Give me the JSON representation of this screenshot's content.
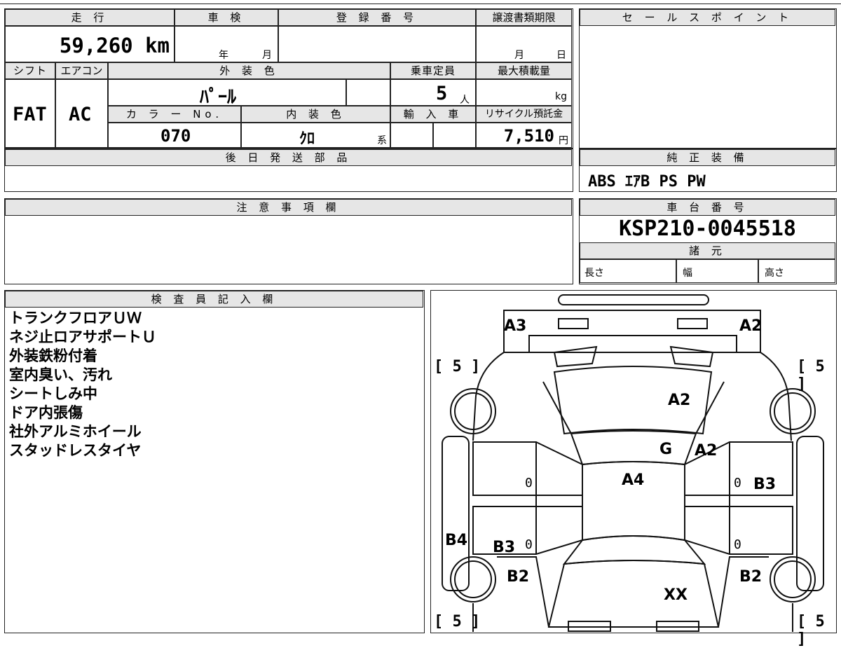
{
  "vehicle": {
    "mileage_label": "走 行",
    "mileage_value": "59,260 km",
    "inspection_label": "車 検",
    "inspection_year": "年",
    "inspection_month": "月",
    "registration_label": "登 録 番 号",
    "transfer_label": "譲渡書類期限",
    "transfer_month": "月",
    "transfer_day": "日",
    "shift_label": "シフト",
    "shift_value": "FAT",
    "aircon_label": "エアコン",
    "aircon_value": "AC",
    "exterior_label": "外 装 色",
    "exterior_value": "ﾊﾟｰﾙ",
    "capacity_label": "乗車定員",
    "capacity_value": "5",
    "capacity_unit": "人",
    "maxload_label": "最大積載量",
    "maxload_unit": "kg",
    "color_no_label": "カ ラ ー No.",
    "color_no_value": "070",
    "interior_label": "内 装 色",
    "interior_value": "ｸﾛ",
    "interior_suffix": "系",
    "import_label": "輸 入 車",
    "recycle_label": "リサイクル預託金",
    "recycle_value": "7,510",
    "recycle_unit": "円"
  },
  "sales_point_label": "セ ー ル ス ポ イ ン ト",
  "later_parts_label": "後 日 発 送 部 品",
  "genuine_equipment_label": "純 正 装 備",
  "genuine_equipment_value": "ABS ｴｱB PS PW",
  "caution_label": "注 意 事 項 欄",
  "chassis_label": "車 台 番 号",
  "chassis_value": "KSP210-0045518",
  "specs_label": "諸 元",
  "specs": {
    "length": "長さ",
    "width": "幅",
    "height": "高さ"
  },
  "inspector_label": "検 査 員 記 入 欄",
  "inspector_notes": [
    "トランクフロアＵＷ",
    "ネジ止ロアサポートＵ",
    "外装鉄粉付着",
    "室内臭い、汚れ",
    "シートしみ中",
    "ドア内張傷",
    "社外アルミホイール",
    "スタッドレスタイヤ"
  ],
  "diagram": {
    "a3": "A3",
    "a2_rear_right": "A2",
    "a2_trunk": "A2",
    "g": "G",
    "a2_roof": "A2",
    "a4": "A4",
    "b3_right": "B3",
    "b4": "B4",
    "b3_left": "B3",
    "b2_left": "B2",
    "b2_right": "B2",
    "xx": "XX",
    "zero": "0",
    "tire": "5"
  }
}
